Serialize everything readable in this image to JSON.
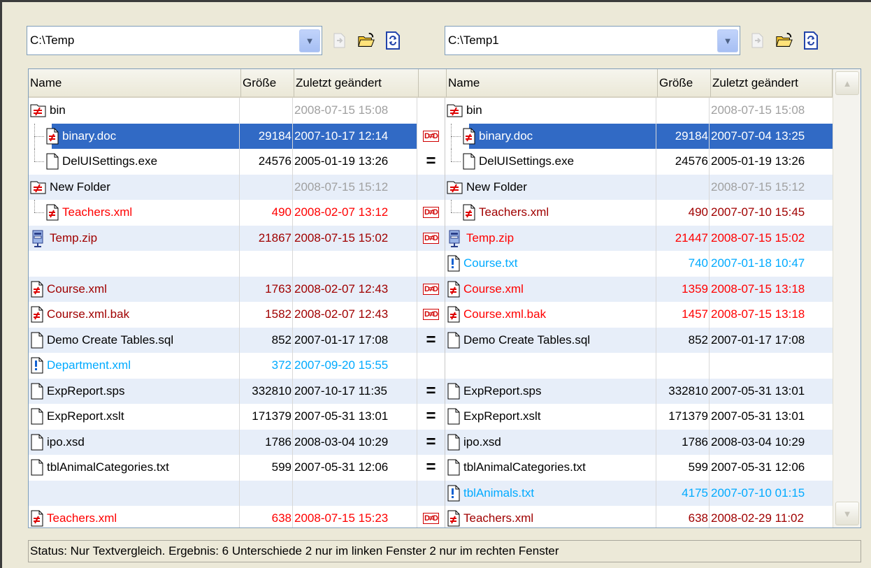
{
  "left_path": "C:\\Temp",
  "right_path": "C:\\Temp1",
  "columns": {
    "name": "Name",
    "size": "Größe",
    "date": "Zuletzt geändert"
  },
  "rows": [
    {
      "l": {
        "name": "bin",
        "size": "",
        "date": "2008-07-15 15:08",
        "icon": "folder-diff-icon",
        "indent": 0,
        "color": "black",
        "dateColor": "gray"
      },
      "cmp": "",
      "r": {
        "name": "bin",
        "size": "",
        "date": "2008-07-15 15:08",
        "icon": "folder-diff-icon",
        "indent": 0,
        "color": "black",
        "dateColor": "gray"
      }
    },
    {
      "l": {
        "name": "binary.doc",
        "size": "29184",
        "date": "2007-10-17 12:14",
        "icon": "file-diff-icon",
        "indent": 1,
        "tree": "mid",
        "color": "white"
      },
      "cmp": "ne",
      "r": {
        "name": "binary.doc",
        "size": "29184",
        "date": "2007-07-04 13:25",
        "icon": "file-diff-icon",
        "indent": 1,
        "tree": "mid",
        "color": "white"
      },
      "selected": true
    },
    {
      "l": {
        "name": "DelUISettings.exe",
        "size": "24576",
        "date": "2005-01-19 13:26",
        "icon": "file-icon",
        "indent": 1,
        "tree": "end",
        "color": "black"
      },
      "cmp": "eq",
      "r": {
        "name": "DelUISettings.exe",
        "size": "24576",
        "date": "2005-01-19 13:26",
        "icon": "file-icon",
        "indent": 1,
        "tree": "end",
        "color": "black"
      }
    },
    {
      "l": {
        "name": "New Folder",
        "size": "",
        "date": "2008-07-15 15:12",
        "icon": "folder-diff-icon",
        "indent": 0,
        "color": "black",
        "dateColor": "gray"
      },
      "cmp": "",
      "r": {
        "name": "New Folder",
        "size": "",
        "date": "2008-07-15 15:12",
        "icon": "folder-diff-icon",
        "indent": 0,
        "color": "black",
        "dateColor": "gray"
      }
    },
    {
      "l": {
        "name": "Teachers.xml",
        "size": "490",
        "date": "2008-02-07 13:12",
        "icon": "file-diff-icon",
        "indent": 1,
        "tree": "end",
        "color": "red"
      },
      "cmp": "ne",
      "r": {
        "name": "Teachers.xml",
        "size": "490",
        "date": "2007-07-10 15:45",
        "icon": "file-diff-icon",
        "indent": 1,
        "tree": "end",
        "color": "dred"
      }
    },
    {
      "l": {
        "name": "Temp.zip",
        "size": "21867",
        "date": "2008-07-15 15:02",
        "icon": "zip-icon",
        "indent": 0,
        "color": "dred"
      },
      "cmp": "ne",
      "r": {
        "name": "Temp.zip",
        "size": "21447",
        "date": "2008-07-15 15:02",
        "icon": "zip-icon",
        "indent": 0,
        "color": "red"
      }
    },
    {
      "l": {
        "name": "",
        "size": "",
        "date": "",
        "icon": "",
        "indent": 0,
        "color": "black"
      },
      "cmp": "",
      "r": {
        "name": "Course.txt",
        "size": "740",
        "date": "2007-01-18 10:47",
        "icon": "file-unique-icon",
        "indent": 0,
        "color": "cyan"
      }
    },
    {
      "l": {
        "name": "Course.xml",
        "size": "1763",
        "date": "2008-02-07 12:43",
        "icon": "file-diff-icon",
        "indent": 0,
        "color": "dred"
      },
      "cmp": "ne",
      "r": {
        "name": "Course.xml",
        "size": "1359",
        "date": "2008-07-15 13:18",
        "icon": "file-diff-icon",
        "indent": 0,
        "color": "red"
      }
    },
    {
      "l": {
        "name": "Course.xml.bak",
        "size": "1582",
        "date": "2008-02-07 12:43",
        "icon": "file-diff-icon",
        "indent": 0,
        "color": "dred"
      },
      "cmp": "ne",
      "r": {
        "name": "Course.xml.bak",
        "size": "1457",
        "date": "2008-07-15 13:18",
        "icon": "file-diff-icon",
        "indent": 0,
        "color": "red"
      }
    },
    {
      "l": {
        "name": "Demo Create Tables.sql",
        "size": "852",
        "date": "2007-01-17 17:08",
        "icon": "file-icon",
        "indent": 0,
        "color": "black"
      },
      "cmp": "eq",
      "r": {
        "name": "Demo Create Tables.sql",
        "size": "852",
        "date": "2007-01-17 17:08",
        "icon": "file-icon",
        "indent": 0,
        "color": "black"
      }
    },
    {
      "l": {
        "name": "Department.xml",
        "size": "372",
        "date": "2007-09-20 15:55",
        "icon": "file-unique-icon",
        "indent": 0,
        "color": "cyan"
      },
      "cmp": "",
      "r": {
        "name": "",
        "size": "",
        "date": "",
        "icon": "",
        "indent": 0,
        "color": "black"
      }
    },
    {
      "l": {
        "name": "ExpReport.sps",
        "size": "332810",
        "date": "2007-10-17 11:35",
        "icon": "file-icon",
        "indent": 0,
        "color": "black"
      },
      "cmp": "eq",
      "r": {
        "name": "ExpReport.sps",
        "size": "332810",
        "date": "2007-05-31 13:01",
        "icon": "file-icon",
        "indent": 0,
        "color": "black"
      }
    },
    {
      "l": {
        "name": "ExpReport.xslt",
        "size": "171379",
        "date": "2007-05-31 13:01",
        "icon": "file-icon",
        "indent": 0,
        "color": "black"
      },
      "cmp": "eq",
      "r": {
        "name": "ExpReport.xslt",
        "size": "171379",
        "date": "2007-05-31 13:01",
        "icon": "file-icon",
        "indent": 0,
        "color": "black"
      }
    },
    {
      "l": {
        "name": "ipo.xsd",
        "size": "1786",
        "date": "2008-03-04 10:29",
        "icon": "file-icon",
        "indent": 0,
        "color": "black"
      },
      "cmp": "eq",
      "r": {
        "name": "ipo.xsd",
        "size": "1786",
        "date": "2008-03-04 10:29",
        "icon": "file-icon",
        "indent": 0,
        "color": "black"
      }
    },
    {
      "l": {
        "name": "tblAnimalCategories.txt",
        "size": "599",
        "date": "2007-05-31 12:06",
        "icon": "file-icon",
        "indent": 0,
        "color": "black"
      },
      "cmp": "eq",
      "r": {
        "name": "tblAnimalCategories.txt",
        "size": "599",
        "date": "2007-05-31 12:06",
        "icon": "file-icon",
        "indent": 0,
        "color": "black"
      }
    },
    {
      "l": {
        "name": "",
        "size": "",
        "date": "",
        "icon": "",
        "indent": 0,
        "color": "black"
      },
      "cmp": "",
      "r": {
        "name": "tblAnimals.txt",
        "size": "4175",
        "date": "2007-07-10 01:15",
        "icon": "file-unique-icon",
        "indent": 0,
        "color": "cyan"
      }
    },
    {
      "l": {
        "name": "Teachers.xml",
        "size": "638",
        "date": "2008-07-15 15:23",
        "icon": "file-diff-icon",
        "indent": 0,
        "color": "red"
      },
      "cmp": "ne",
      "r": {
        "name": "Teachers.xml",
        "size": "638",
        "date": "2008-02-29 11:02",
        "icon": "file-diff-icon",
        "indent": 0,
        "color": "dred"
      }
    }
  ],
  "cmp_labels": {
    "eq": "=",
    "ne": "D≠D"
  },
  "status": "Status: Nur Textvergleich. Ergebnis: 6 Unterschiede 2 nur im linken Fenster 2 nur im rechten Fenster"
}
